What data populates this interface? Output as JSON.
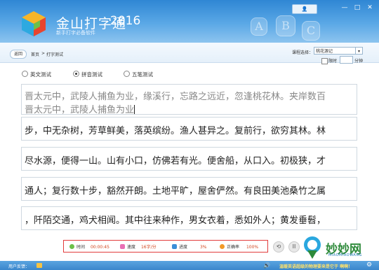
{
  "app": {
    "title": "金山打字通",
    "year": "2016",
    "subtitle": "新手打字必备软件",
    "user_button": "▲ ▼",
    "window_controls": [
      "—",
      "□",
      "✕"
    ]
  },
  "nav": {
    "back": "返回",
    "breadcrumb": [
      "首页",
      ">",
      "打字测试"
    ],
    "course_label": "课程选择：",
    "course_value": "桃花源记",
    "timer_label": "限时",
    "timer_unit": "分钟",
    "timer_value": ""
  },
  "modes": [
    {
      "label": "英文测试",
      "selected": false
    },
    {
      "label": "拼音测试",
      "selected": true
    },
    {
      "label": "五笔测试",
      "selected": false
    }
  ],
  "lines": {
    "line1_source": "晋太元中，武陵人捕鱼为业，缘溪行，忘路之远近，忽逢桃花林。夹岸数百",
    "line1_typed": "晋太元中，武陵人捕鱼为业",
    "line2": "步，中无杂树，芳草鲜美，落英缤纷。渔人甚异之。复前行，欲穷其林。林",
    "line3": "尽水源，便得一山。山有小口，仿佛若有光。便舍船，从口入。初极狭，才",
    "line4": "通人；复行数十步，豁然开朗。土地平旷，屋舍俨然。有良田美池桑竹之属",
    "line5": "，阡陌交通，鸡犬相闻。其中往来种作，男女衣着，悉如外人；黄发垂髫，"
  },
  "stats": {
    "time_label": "时间",
    "time_value": "00:00:45",
    "speed_label": "速度",
    "speed_value": "16字/分",
    "progress_label": "进度",
    "progress_value": "3%",
    "accuracy_label": "正确率",
    "accuracy_value": "100%"
  },
  "controls": {
    "restart_icon": "⟲",
    "pause_icon": "II"
  },
  "watermark": {
    "title": "妙妙网",
    "subtitle": "MIAOMIAOWANG"
  },
  "bottom": {
    "feedback": "用户反馈：",
    "tip": "温暖英语超级的物理要来是它于 啊啊！"
  },
  "colors": {
    "header": "#3a8ed8",
    "accent_value": "#d2451e",
    "stats_border": "#e23b3b"
  }
}
